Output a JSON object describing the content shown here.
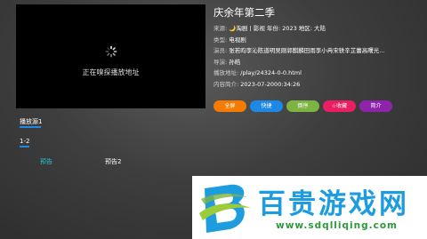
{
  "player": {
    "status_text": "正在嗅探播放地址"
  },
  "info": {
    "title": "庆余年第二季",
    "rows": [
      {
        "label": "来源:",
        "value": "🌙淘剧丨影视 年份: 2023  地区: 大陆"
      },
      {
        "label": "类型:",
        "value": "电视剧"
      },
      {
        "label": "演员:",
        "value": "张若昀李沁陈道明吴刚郭麒麟田雨李小冉宋轶辛芷蕾高曙光..."
      },
      {
        "label": "导演:",
        "value": "孙皓"
      },
      {
        "label": "播放地址:",
        "value": "/play/24324-0-0.html"
      },
      {
        "label": "内容简介:",
        "value": "2023-07-2000:34:26"
      }
    ]
  },
  "actions": [
    {
      "label": "全屏",
      "color": "#f57c00"
    },
    {
      "label": "快捷",
      "color": "#1e88e5"
    },
    {
      "label": "倒序",
      "color": "#7cb342"
    },
    {
      "label": "☆收藏",
      "color": "#e91e63"
    },
    {
      "label": "简介",
      "color": "#8e24aa"
    }
  ],
  "source_tab": "播放源1",
  "episode_range": "1-2",
  "episodes": [
    {
      "label": "预告",
      "color": "#26c6da"
    },
    {
      "label": "预告2",
      "color": "#ffffff"
    }
  ],
  "banner": {
    "brand": "百贵游戏网",
    "url": "www.sdqlliqing.com"
  }
}
